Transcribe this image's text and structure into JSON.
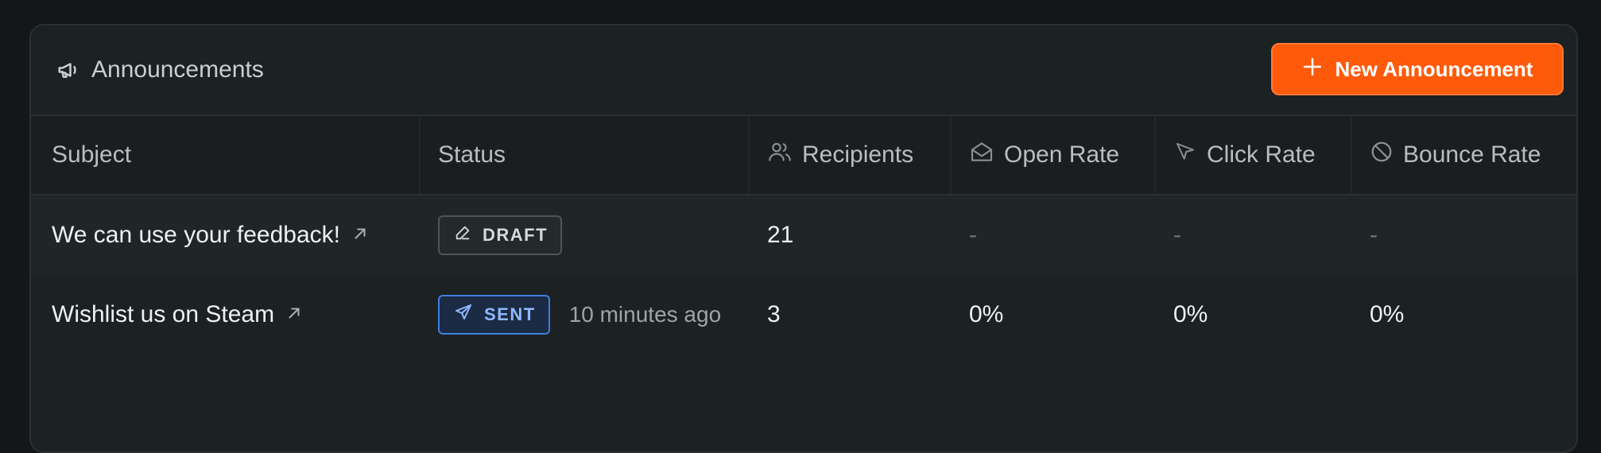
{
  "header": {
    "title": "Announcements",
    "title_icon": "megaphone-icon",
    "new_button_label": "New Announcement",
    "new_button_icon": "plus-icon",
    "accent": "#ff5a0a"
  },
  "table": {
    "columns": [
      {
        "label": "Subject",
        "icon": ""
      },
      {
        "label": "Status",
        "icon": ""
      },
      {
        "label": "Recipients",
        "icon": "users-icon"
      },
      {
        "label": "Open Rate",
        "icon": "open-envelope-icon"
      },
      {
        "label": "Click Rate",
        "icon": "cursor-icon"
      },
      {
        "label": "Bounce Rate",
        "icon": "ban-icon"
      }
    ],
    "rows": [
      {
        "subject": "We can use your feedback!",
        "status": "DRAFT",
        "status_icon": "pencil-icon",
        "time": "",
        "recipients": "21",
        "open_rate": "-",
        "click_rate": "-",
        "bounce_rate": "-"
      },
      {
        "subject": "Wishlist us on Steam",
        "status": "SENT",
        "status_icon": "send-icon",
        "time": "10 minutes ago",
        "recipients": "3",
        "open_rate": "0%",
        "click_rate": "0%",
        "bounce_rate": "0%"
      }
    ]
  },
  "colors": {
    "background": "#131718",
    "panel": "#1c2122",
    "draft_border": "#4c5757",
    "sent_border": "#3f7fe0",
    "sent_text": "#8fb9ff"
  }
}
